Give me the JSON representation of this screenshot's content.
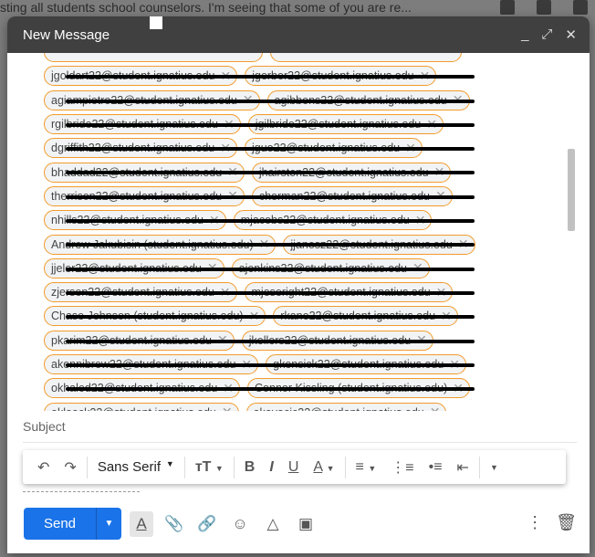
{
  "background": {
    "snippet": "sting all students school counselors. I'm seeing that some of you are re..."
  },
  "compose": {
    "title": "New Message",
    "controls": {
      "minimize": "_",
      "expand": "⤢",
      "close": "✕"
    },
    "recipients": [
      [
        "jgoldart22@student.ignatius.edu",
        "jgerber22@student.ignatius.edu"
      ],
      [
        "agiampietro22@student.ignatius.edu",
        "agibbons22@student.ignatius.edu"
      ],
      [
        "rgilbride22@student.ignatius.edu",
        "jgilbride22@student.ignatius.edu"
      ],
      [
        "dgriffith22@student.ignatius.edu",
        "jguo22@student.ignatius.edu"
      ],
      [
        "bhaddad22@student.ignatius.edu",
        "jhairston22@student.ignatius.edu"
      ],
      [
        "therrison22@student.ignatius.edu",
        "cherman22@student.ignatius.edu"
      ],
      [
        "nhills22@student.ignatius.edu",
        "mjacobs22@student.ignatius.edu"
      ],
      [
        "Andrew Jakubisin (student.ignatius.edu)",
        "jjanosz22@student.ignatius.edu"
      ],
      [
        "jjeler22@student.ignatius.edu",
        "ajenkins22@student.ignatius.edu"
      ],
      [
        "zjersen22@student.ignatius.edu",
        "mjeseright22@student.ignatius.edu"
      ],
      [
        "Chase Johnson (student.ignatius.edu)",
        "rkane22@student.ignatius.edu"
      ],
      [
        "pkarim22@student.ignatius.edu",
        "jkellers22@student.ignatius.edu"
      ],
      [
        "akennibrew22@student.ignatius.edu",
        "gkensick22@student.ignatius.edu"
      ],
      [
        "okhaled22@student.ignatius.edu",
        "Connor Kissling (student.ignatius.edu)"
      ],
      [
        "okloock22@student.ignatius.edu",
        "akovacic22@student.ignatius.edu"
      ]
    ],
    "subject_placeholder": "Subject",
    "toolbar": {
      "font": "Sans Serif"
    },
    "send_label": "Send"
  }
}
